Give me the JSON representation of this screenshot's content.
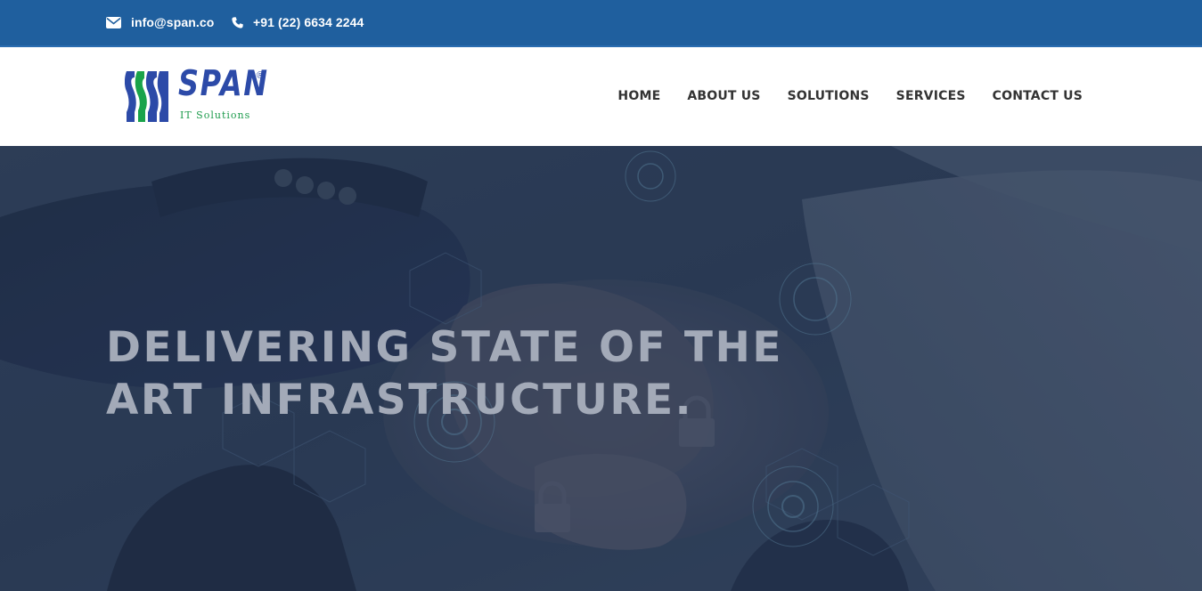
{
  "topbar": {
    "email": "info@span.co",
    "phone": "+91 (22) 6634 2244",
    "email_icon": "envelope-icon",
    "phone_icon": "phone-icon"
  },
  "logo": {
    "brand": "SPAN",
    "registered": "®",
    "tagline": "IT Solutions"
  },
  "nav": {
    "items": [
      {
        "label": "HOME"
      },
      {
        "label": "ABOUT US"
      },
      {
        "label": "SOLUTIONS"
      },
      {
        "label": "SERVICES"
      },
      {
        "label": "CONTACT US"
      }
    ]
  },
  "hero": {
    "line1": "DELIVERING STATE OF THE",
    "line2": "ART INFRASTRUCTURE."
  },
  "colors": {
    "topbar": "#1f5f9e",
    "brand_blue": "#2c4aa8",
    "brand_green": "#1a9a4a",
    "hero_overlay": "#2a3a55",
    "headline": "#a3aab8"
  }
}
